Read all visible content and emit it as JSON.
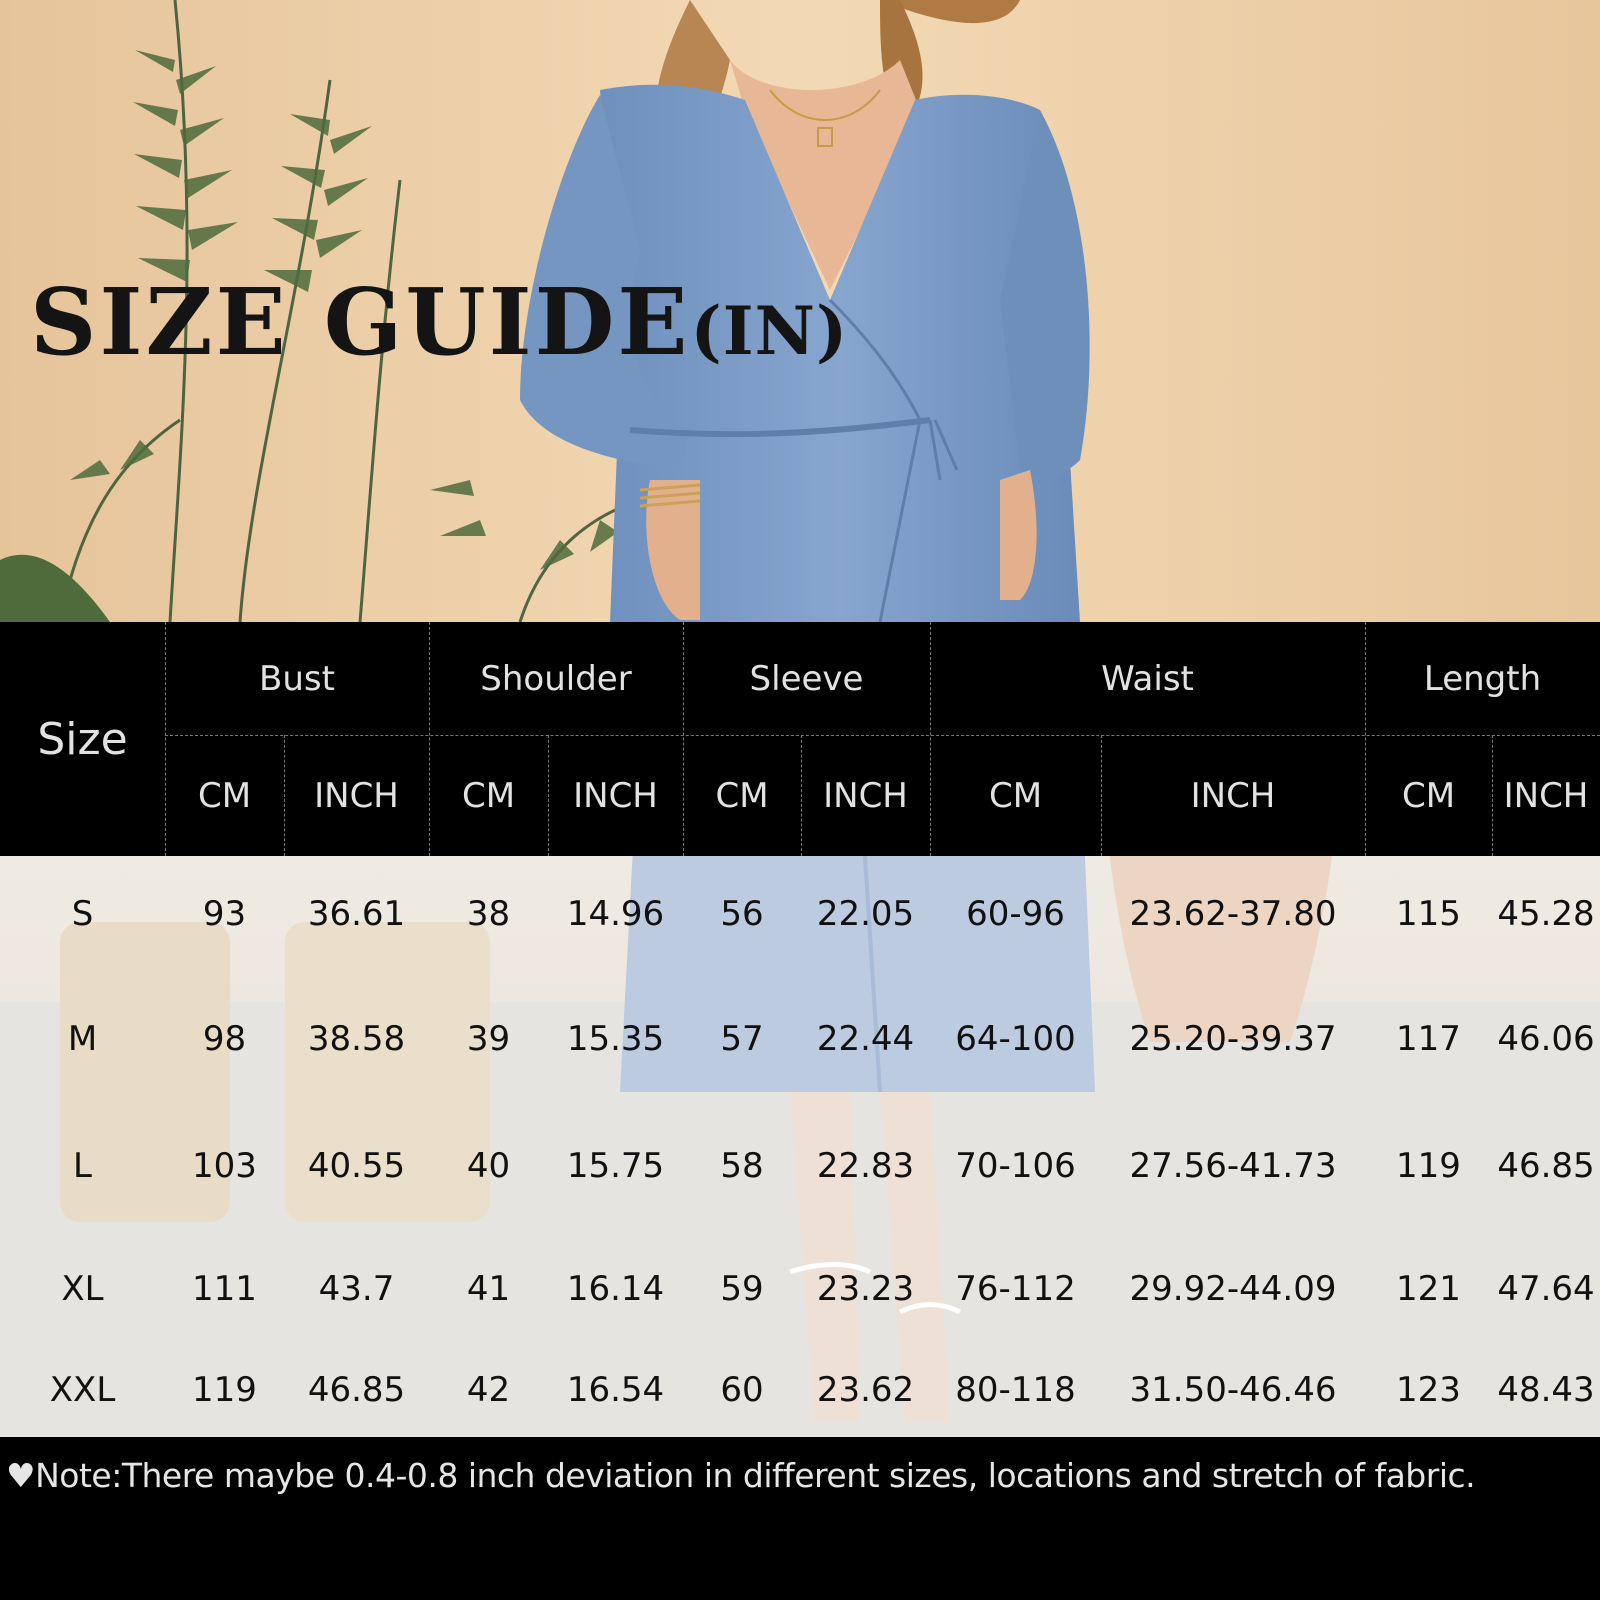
{
  "title": {
    "main": "SIZE GUIDE",
    "unit": "(IN)"
  },
  "table": {
    "size_header": "Size",
    "groups": [
      "Bust",
      "Shoulder",
      "Sleeve",
      "Waist",
      "Length"
    ],
    "units": [
      "CM",
      "INCH",
      "CM",
      "INCH",
      "CM",
      "INCH",
      "CM",
      "INCH",
      "CM",
      "INCH"
    ],
    "rows": [
      [
        "S",
        "93",
        "36.61",
        "38",
        "14.96",
        "56",
        "22.05",
        "60-96",
        "23.62-37.80",
        "115",
        "45.28"
      ],
      [
        "M",
        "98",
        "38.58",
        "39",
        "15.35",
        "57",
        "22.44",
        "64-100",
        "25.20-39.37",
        "117",
        "46.06"
      ],
      [
        "L",
        "103",
        "40.55",
        "40",
        "15.75",
        "58",
        "22.83",
        "70-106",
        "27.56-41.73",
        "119",
        "46.85"
      ],
      [
        "XL",
        "111",
        "43.7",
        "41",
        "16.14",
        "59",
        "23.23",
        "76-112",
        "29.92-44.09",
        "121",
        "47.64"
      ],
      [
        "XXL",
        "119",
        "46.85",
        "42",
        "16.54",
        "60",
        "23.62",
        "80-118",
        "31.50-46.46",
        "123",
        "48.43"
      ]
    ]
  },
  "note": "♥Note:There maybe 0.4-0.8 inch deviation in different sizes, locations and stretch of fabric.",
  "colors": {
    "header_bg": "#000000",
    "dress_blue": "#7d9dc9",
    "header_text": "#e2e2e2",
    "body_text": "#111111"
  }
}
